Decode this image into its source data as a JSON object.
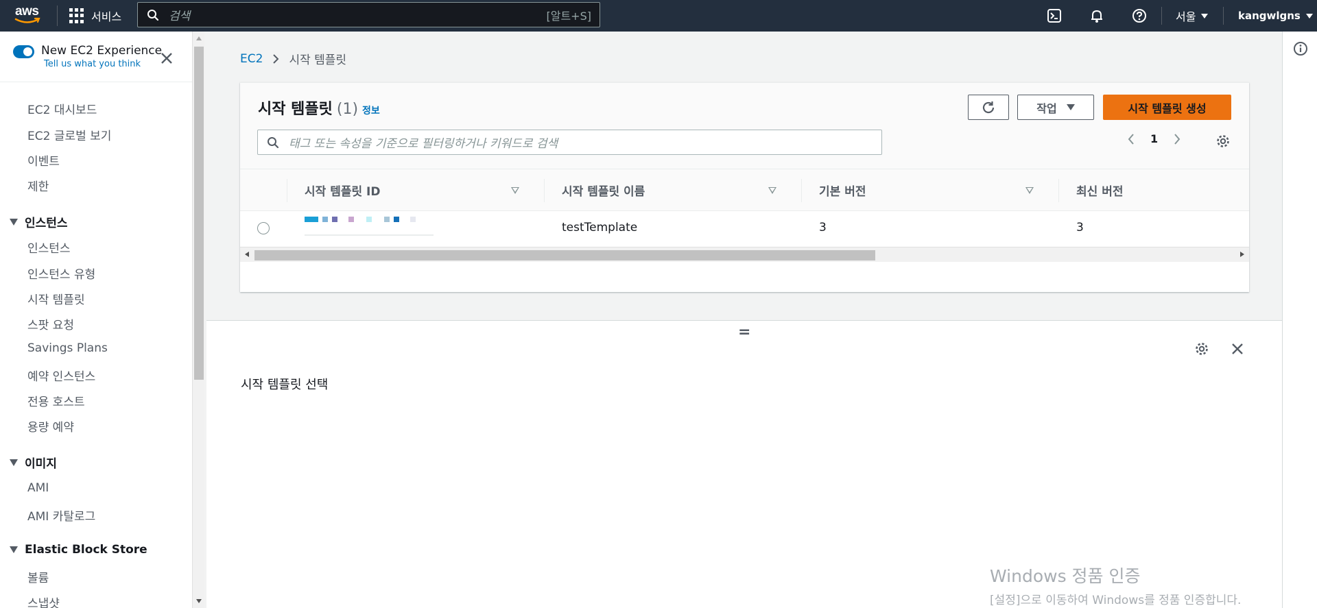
{
  "topnav": {
    "logo_text": "aws",
    "services_label": "서비스",
    "search_placeholder": "검색",
    "search_shortcut": "[알트+S]",
    "icons": [
      "cloudshell-icon",
      "bell-icon",
      "help-icon"
    ],
    "region": "서울",
    "username": "kangwlgns"
  },
  "sidebar": {
    "experience_title": "New EC2 Experience",
    "experience_link": "Tell us what you think",
    "top_items": [
      "EC2 대시보드",
      "EC2 글로벌 보기",
      "이벤트",
      "제한"
    ],
    "sections": [
      {
        "title": "인스턴스",
        "items": [
          "인스턴스",
          "인스턴스 유형",
          "시작 템플릿",
          "스팟 요청",
          "Savings Plans",
          "예약 인스턴스",
          "전용 호스트",
          "용량 예약"
        ]
      },
      {
        "title": "이미지",
        "items": [
          "AMI",
          "AMI 카탈로그"
        ]
      },
      {
        "title": "Elastic Block Store",
        "items": [
          "볼륨",
          "스냅샷"
        ]
      }
    ]
  },
  "breadcrumb": {
    "root": "EC2",
    "current": "시작 템플릿"
  },
  "table": {
    "title": "시작 템플릿",
    "count": "(1)",
    "info_link": "정보",
    "refresh_icon": "refresh-icon",
    "actions_label": "작업",
    "create_label": "시작 템플릿 생성",
    "filter_placeholder": "태그 또는 속성을 기준으로 필터링하거나 키워드로 검색",
    "page": "1",
    "columns": [
      "시작 템플릿 ID",
      "시작 템플릿 이름",
      "기본 버전",
      "최신 버전"
    ],
    "rows": [
      {
        "id": "",
        "name": "testTemplate",
        "default_version": "3",
        "latest_version": "3"
      }
    ]
  },
  "split_panel": {
    "message": "시작 템플릿 선택",
    "handle": "="
  },
  "watermark": {
    "line1": "Windows 정품 인증",
    "line2": "[설정]으로 이동하여 Windows를 정품 인증합니다."
  },
  "colors": {
    "nav_bg": "#232f3e",
    "accent_link": "#0073bb",
    "primary_button": "#ec7211"
  }
}
